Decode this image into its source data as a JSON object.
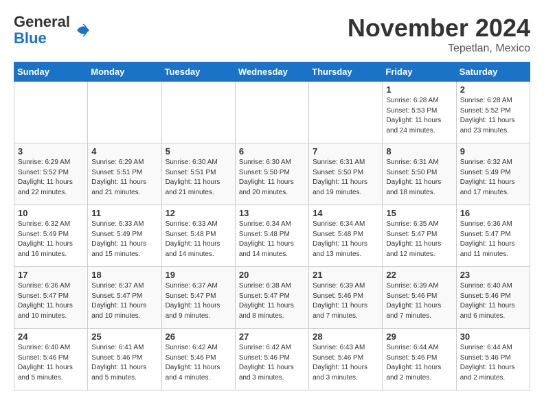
{
  "header": {
    "logo_general": "General",
    "logo_blue": "Blue",
    "month": "November 2024",
    "location": "Tepetlan, Mexico"
  },
  "weekdays": [
    "Sunday",
    "Monday",
    "Tuesday",
    "Wednesday",
    "Thursday",
    "Friday",
    "Saturday"
  ],
  "weeks": [
    [
      {
        "day": "",
        "info": ""
      },
      {
        "day": "",
        "info": ""
      },
      {
        "day": "",
        "info": ""
      },
      {
        "day": "",
        "info": ""
      },
      {
        "day": "",
        "info": ""
      },
      {
        "day": "1",
        "info": "Sunrise: 6:28 AM\nSunset: 5:53 PM\nDaylight: 11 hours\nand 24 minutes."
      },
      {
        "day": "2",
        "info": "Sunrise: 6:28 AM\nSunset: 5:52 PM\nDaylight: 11 hours\nand 23 minutes."
      }
    ],
    [
      {
        "day": "3",
        "info": "Sunrise: 6:29 AM\nSunset: 5:52 PM\nDaylight: 11 hours\nand 22 minutes."
      },
      {
        "day": "4",
        "info": "Sunrise: 6:29 AM\nSunset: 5:51 PM\nDaylight: 11 hours\nand 21 minutes."
      },
      {
        "day": "5",
        "info": "Sunrise: 6:30 AM\nSunset: 5:51 PM\nDaylight: 11 hours\nand 21 minutes."
      },
      {
        "day": "6",
        "info": "Sunrise: 6:30 AM\nSunset: 5:50 PM\nDaylight: 11 hours\nand 20 minutes."
      },
      {
        "day": "7",
        "info": "Sunrise: 6:31 AM\nSunset: 5:50 PM\nDaylight: 11 hours\nand 19 minutes."
      },
      {
        "day": "8",
        "info": "Sunrise: 6:31 AM\nSunset: 5:50 PM\nDaylight: 11 hours\nand 18 minutes."
      },
      {
        "day": "9",
        "info": "Sunrise: 6:32 AM\nSunset: 5:49 PM\nDaylight: 11 hours\nand 17 minutes."
      }
    ],
    [
      {
        "day": "10",
        "info": "Sunrise: 6:32 AM\nSunset: 5:49 PM\nDaylight: 11 hours\nand 16 minutes."
      },
      {
        "day": "11",
        "info": "Sunrise: 6:33 AM\nSunset: 5:49 PM\nDaylight: 11 hours\nand 15 minutes."
      },
      {
        "day": "12",
        "info": "Sunrise: 6:33 AM\nSunset: 5:48 PM\nDaylight: 11 hours\nand 14 minutes."
      },
      {
        "day": "13",
        "info": "Sunrise: 6:34 AM\nSunset: 5:48 PM\nDaylight: 11 hours\nand 14 minutes."
      },
      {
        "day": "14",
        "info": "Sunrise: 6:34 AM\nSunset: 5:48 PM\nDaylight: 11 hours\nand 13 minutes."
      },
      {
        "day": "15",
        "info": "Sunrise: 6:35 AM\nSunset: 5:47 PM\nDaylight: 11 hours\nand 12 minutes."
      },
      {
        "day": "16",
        "info": "Sunrise: 6:36 AM\nSunset: 5:47 PM\nDaylight: 11 hours\nand 11 minutes."
      }
    ],
    [
      {
        "day": "17",
        "info": "Sunrise: 6:36 AM\nSunset: 5:47 PM\nDaylight: 11 hours\nand 10 minutes."
      },
      {
        "day": "18",
        "info": "Sunrise: 6:37 AM\nSunset: 5:47 PM\nDaylight: 11 hours\nand 10 minutes."
      },
      {
        "day": "19",
        "info": "Sunrise: 6:37 AM\nSunset: 5:47 PM\nDaylight: 11 hours\nand 9 minutes."
      },
      {
        "day": "20",
        "info": "Sunrise: 6:38 AM\nSunset: 5:47 PM\nDaylight: 11 hours\nand 8 minutes."
      },
      {
        "day": "21",
        "info": "Sunrise: 6:39 AM\nSunset: 5:46 PM\nDaylight: 11 hours\nand 7 minutes."
      },
      {
        "day": "22",
        "info": "Sunrise: 6:39 AM\nSunset: 5:46 PM\nDaylight: 11 hours\nand 7 minutes."
      },
      {
        "day": "23",
        "info": "Sunrise: 6:40 AM\nSunset: 5:46 PM\nDaylight: 11 hours\nand 6 minutes."
      }
    ],
    [
      {
        "day": "24",
        "info": "Sunrise: 6:40 AM\nSunset: 5:46 PM\nDaylight: 11 hours\nand 5 minutes."
      },
      {
        "day": "25",
        "info": "Sunrise: 6:41 AM\nSunset: 5:46 PM\nDaylight: 11 hours\nand 5 minutes."
      },
      {
        "day": "26",
        "info": "Sunrise: 6:42 AM\nSunset: 5:46 PM\nDaylight: 11 hours\nand 4 minutes."
      },
      {
        "day": "27",
        "info": "Sunrise: 6:42 AM\nSunset: 5:46 PM\nDaylight: 11 hours\nand 3 minutes."
      },
      {
        "day": "28",
        "info": "Sunrise: 6:43 AM\nSunset: 5:46 PM\nDaylight: 11 hours\nand 3 minutes."
      },
      {
        "day": "29",
        "info": "Sunrise: 6:44 AM\nSunset: 5:46 PM\nDaylight: 11 hours\nand 2 minutes."
      },
      {
        "day": "30",
        "info": "Sunrise: 6:44 AM\nSunset: 5:46 PM\nDaylight: 11 hours\nand 2 minutes."
      }
    ]
  ]
}
